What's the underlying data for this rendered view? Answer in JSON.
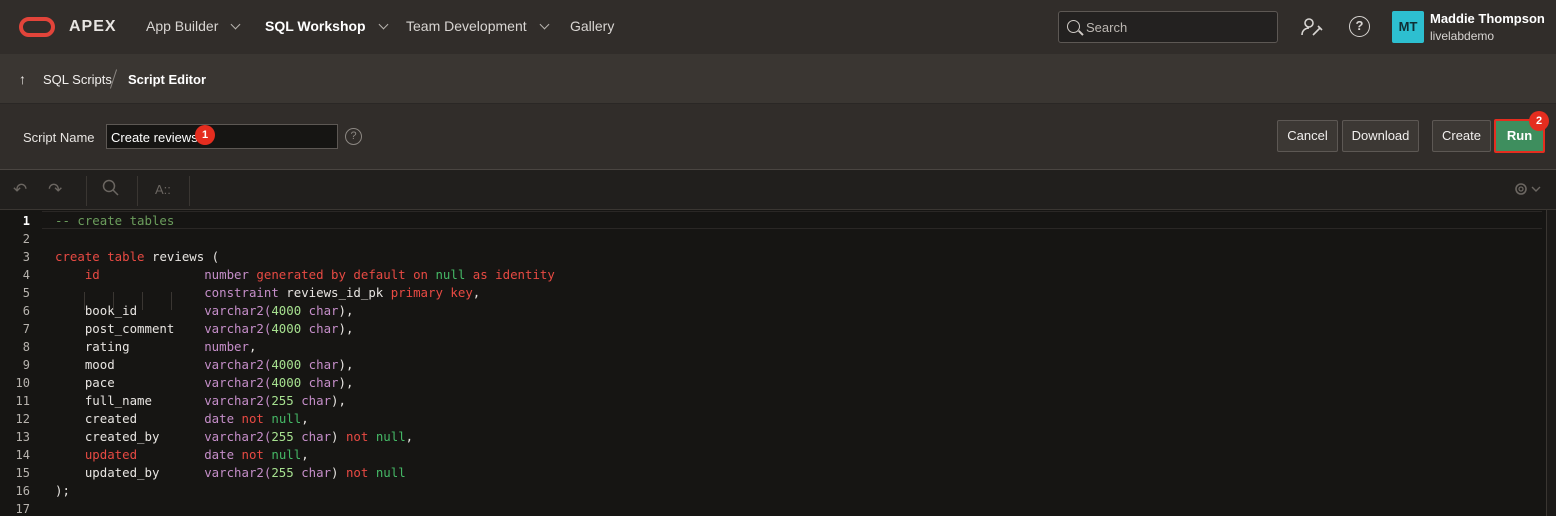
{
  "app": {
    "logo_text": "APEX"
  },
  "nav": {
    "items": [
      {
        "label": "App Builder"
      },
      {
        "label": "SQL Workshop"
      },
      {
        "label": "Team Development"
      },
      {
        "label": "Gallery"
      }
    ],
    "search_placeholder": "Search"
  },
  "user": {
    "initials": "MT",
    "name": "Maddie Thompson",
    "workspace": "livelabdemo"
  },
  "breadcrumb": {
    "parent": "SQL Scripts",
    "current": "Script Editor"
  },
  "script": {
    "name_label": "Script Name",
    "name_value": "Create reviews",
    "badge1": "1",
    "badge2": "2"
  },
  "buttons": {
    "cancel": "Cancel",
    "download": "Download",
    "create": "Create",
    "run": "Run"
  },
  "toolbar": {
    "text_tool": "A::"
  },
  "code": {
    "line_numbers": [
      "1",
      "2",
      "3",
      "4",
      "5",
      "6",
      "7",
      "8",
      "9",
      "10",
      "11",
      "12",
      "13",
      "14",
      "15",
      "16",
      "17"
    ],
    "lines": [
      [
        {
          "t": "-- create tables",
          "c": "c-comment"
        }
      ],
      [],
      [
        {
          "t": "create table",
          "c": "c-kw"
        },
        {
          "t": " reviews (",
          "c": ""
        }
      ],
      [
        {
          "t": "    ",
          "c": ""
        },
        {
          "t": "id",
          "c": "c-kw"
        },
        {
          "t": "              ",
          "c": ""
        },
        {
          "t": "number",
          "c": "c-type"
        },
        {
          "t": " generated by default on ",
          "c": "c-kw"
        },
        {
          "t": "null",
          "c": "c-null"
        },
        {
          "t": " as identity",
          "c": "c-kw"
        }
      ],
      [
        {
          "t": "                    ",
          "c": ""
        },
        {
          "t": "constraint",
          "c": "c-type"
        },
        {
          "t": " reviews_id_pk ",
          "c": ""
        },
        {
          "t": "primary key",
          "c": "c-kw"
        },
        {
          "t": ",",
          "c": ""
        }
      ],
      [
        {
          "t": "    book_id         ",
          "c": ""
        },
        {
          "t": "varchar2(",
          "c": "c-type"
        },
        {
          "t": "4000",
          "c": "c-num"
        },
        {
          "t": " char",
          "c": "c-type"
        },
        {
          "t": "),",
          "c": ""
        }
      ],
      [
        {
          "t": "    post_comment    ",
          "c": ""
        },
        {
          "t": "varchar2(",
          "c": "c-type"
        },
        {
          "t": "4000",
          "c": "c-num"
        },
        {
          "t": " char",
          "c": "c-type"
        },
        {
          "t": "),",
          "c": ""
        }
      ],
      [
        {
          "t": "    rating          ",
          "c": ""
        },
        {
          "t": "number",
          "c": "c-type"
        },
        {
          "t": ",",
          "c": ""
        }
      ],
      [
        {
          "t": "    mood            ",
          "c": ""
        },
        {
          "t": "varchar2(",
          "c": "c-type"
        },
        {
          "t": "4000",
          "c": "c-num"
        },
        {
          "t": " char",
          "c": "c-type"
        },
        {
          "t": "),",
          "c": ""
        }
      ],
      [
        {
          "t": "    pace            ",
          "c": ""
        },
        {
          "t": "varchar2(",
          "c": "c-type"
        },
        {
          "t": "4000",
          "c": "c-num"
        },
        {
          "t": " char",
          "c": "c-type"
        },
        {
          "t": "),",
          "c": ""
        }
      ],
      [
        {
          "t": "    full_name       ",
          "c": ""
        },
        {
          "t": "varchar2(",
          "c": "c-type"
        },
        {
          "t": "255",
          "c": "c-num"
        },
        {
          "t": " char",
          "c": "c-type"
        },
        {
          "t": "),",
          "c": ""
        }
      ],
      [
        {
          "t": "    created         ",
          "c": ""
        },
        {
          "t": "date",
          "c": "c-type"
        },
        {
          "t": " not ",
          "c": "c-kw"
        },
        {
          "t": "null",
          "c": "c-null"
        },
        {
          "t": ",",
          "c": ""
        }
      ],
      [
        {
          "t": "    created_by      ",
          "c": ""
        },
        {
          "t": "varchar2(",
          "c": "c-type"
        },
        {
          "t": "255",
          "c": "c-num"
        },
        {
          "t": " char",
          "c": "c-type"
        },
        {
          "t": ") ",
          "c": ""
        },
        {
          "t": "not ",
          "c": "c-kw"
        },
        {
          "t": "null",
          "c": "c-null"
        },
        {
          "t": ",",
          "c": ""
        }
      ],
      [
        {
          "t": "    ",
          "c": ""
        },
        {
          "t": "updated",
          "c": "c-kw"
        },
        {
          "t": "         ",
          "c": ""
        },
        {
          "t": "date",
          "c": "c-type"
        },
        {
          "t": " not ",
          "c": "c-kw"
        },
        {
          "t": "null",
          "c": "c-null"
        },
        {
          "t": ",",
          "c": ""
        }
      ],
      [
        {
          "t": "    updated_by      ",
          "c": ""
        },
        {
          "t": "varchar2(",
          "c": "c-type"
        },
        {
          "t": "255",
          "c": "c-num"
        },
        {
          "t": " char",
          "c": "c-type"
        },
        {
          "t": ") ",
          "c": ""
        },
        {
          "t": "not ",
          "c": "c-kw"
        },
        {
          "t": "null",
          "c": "c-null"
        }
      ],
      [
        {
          "t": ");",
          "c": ""
        }
      ],
      []
    ]
  },
  "colors": {
    "run_button": "#3e8e5e",
    "highlight_red": "#e52d1f",
    "avatar": "#2dbfd0"
  }
}
